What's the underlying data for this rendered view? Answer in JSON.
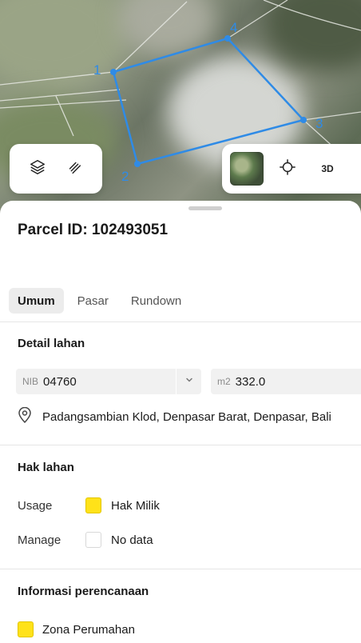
{
  "map": {
    "parcel_vertices": [
      {
        "label": "1"
      },
      {
        "label": "2"
      },
      {
        "label": "3"
      },
      {
        "label": "4"
      }
    ],
    "accent_color": "#2f8be6",
    "layer_buttons": [
      "layers-icon",
      "measure-icon"
    ],
    "basemap_buttons": [
      "satellite-thumbnail",
      "locate-icon"
    ],
    "btn_3d": "3D"
  },
  "sheet": {
    "title": "Parcel ID: 102493051",
    "tabs": [
      {
        "label": "Umum",
        "active": true
      },
      {
        "label": "Pasar",
        "active": false
      },
      {
        "label": "Rundown",
        "active": false
      }
    ],
    "detail": {
      "title": "Detail lahan",
      "nib_prefix": "NIB",
      "nib_value": "04760",
      "area_prefix": "m2",
      "area_value": "332.0",
      "address": "Padangsambian Klod, Denpasar Barat, Denpasar, Bali"
    },
    "rights": {
      "title": "Hak lahan",
      "usage_label": "Usage",
      "usage_value": "Hak Milik",
      "usage_color": "#ffe219",
      "manage_label": "Manage",
      "manage_value": "No data"
    },
    "planning": {
      "title": "Informasi perencanaan",
      "zone_value": "Zona Perumahan",
      "zone_color": "#ffe219"
    }
  }
}
